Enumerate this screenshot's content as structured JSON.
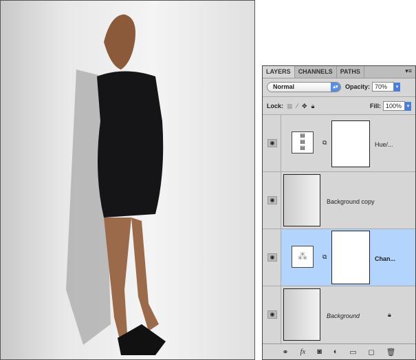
{
  "panel": {
    "tabs": [
      {
        "label": "LAYERS",
        "active": true
      },
      {
        "label": "CHANNELS",
        "active": false
      },
      {
        "label": "PATHS",
        "active": false
      }
    ],
    "panel_menu_icon": "panel-menu-icon",
    "blend_mode": "Normal",
    "opacity_label": "Opacity:",
    "opacity": "70%",
    "lock_label": "Lock:",
    "fill_label": "Fill:",
    "fill": "100%",
    "layers": [
      {
        "name": "Hue/...",
        "type": "adjustment-hue-saturation",
        "selected": false,
        "visible": true
      },
      {
        "name": "Background copy",
        "type": "image",
        "selected": false,
        "visible": true
      },
      {
        "name": "Chan...",
        "type": "adjustment-channel-mixer",
        "selected": true,
        "visible": true
      },
      {
        "name": "Background",
        "type": "image",
        "selected": false,
        "visible": true,
        "locked": true
      }
    ],
    "selection_color": "#b3d4fc"
  }
}
